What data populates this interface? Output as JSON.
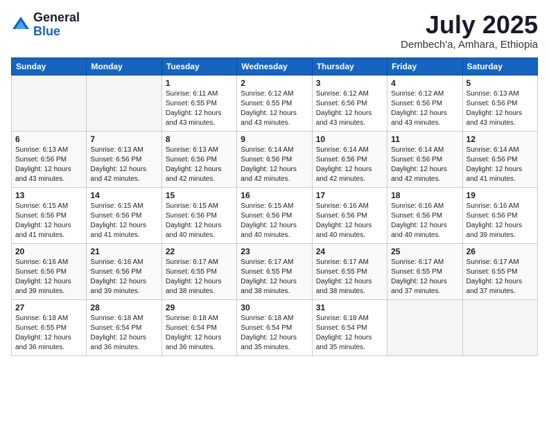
{
  "logo": {
    "general": "General",
    "blue": "Blue"
  },
  "header": {
    "month_year": "July 2025",
    "location": "Dembech'a, Amhara, Ethiopia"
  },
  "days_of_week": [
    "Sunday",
    "Monday",
    "Tuesday",
    "Wednesday",
    "Thursday",
    "Friday",
    "Saturday"
  ],
  "weeks": [
    [
      {
        "day": "",
        "detail": ""
      },
      {
        "day": "",
        "detail": ""
      },
      {
        "day": "1",
        "detail": "Sunrise: 6:11 AM\nSunset: 6:55 PM\nDaylight: 12 hours\nand 43 minutes."
      },
      {
        "day": "2",
        "detail": "Sunrise: 6:12 AM\nSunset: 6:55 PM\nDaylight: 12 hours\nand 43 minutes."
      },
      {
        "day": "3",
        "detail": "Sunrise: 6:12 AM\nSunset: 6:56 PM\nDaylight: 12 hours\nand 43 minutes."
      },
      {
        "day": "4",
        "detail": "Sunrise: 6:12 AM\nSunset: 6:56 PM\nDaylight: 12 hours\nand 43 minutes."
      },
      {
        "day": "5",
        "detail": "Sunrise: 6:13 AM\nSunset: 6:56 PM\nDaylight: 12 hours\nand 43 minutes."
      }
    ],
    [
      {
        "day": "6",
        "detail": "Sunrise: 6:13 AM\nSunset: 6:56 PM\nDaylight: 12 hours\nand 43 minutes."
      },
      {
        "day": "7",
        "detail": "Sunrise: 6:13 AM\nSunset: 6:56 PM\nDaylight: 12 hours\nand 42 minutes."
      },
      {
        "day": "8",
        "detail": "Sunrise: 6:13 AM\nSunset: 6:56 PM\nDaylight: 12 hours\nand 42 minutes."
      },
      {
        "day": "9",
        "detail": "Sunrise: 6:14 AM\nSunset: 6:56 PM\nDaylight: 12 hours\nand 42 minutes."
      },
      {
        "day": "10",
        "detail": "Sunrise: 6:14 AM\nSunset: 6:56 PM\nDaylight: 12 hours\nand 42 minutes."
      },
      {
        "day": "11",
        "detail": "Sunrise: 6:14 AM\nSunset: 6:56 PM\nDaylight: 12 hours\nand 42 minutes."
      },
      {
        "day": "12",
        "detail": "Sunrise: 6:14 AM\nSunset: 6:56 PM\nDaylight: 12 hours\nand 41 minutes."
      }
    ],
    [
      {
        "day": "13",
        "detail": "Sunrise: 6:15 AM\nSunset: 6:56 PM\nDaylight: 12 hours\nand 41 minutes."
      },
      {
        "day": "14",
        "detail": "Sunrise: 6:15 AM\nSunset: 6:56 PM\nDaylight: 12 hours\nand 41 minutes."
      },
      {
        "day": "15",
        "detail": "Sunrise: 6:15 AM\nSunset: 6:56 PM\nDaylight: 12 hours\nand 40 minutes."
      },
      {
        "day": "16",
        "detail": "Sunrise: 6:15 AM\nSunset: 6:56 PM\nDaylight: 12 hours\nand 40 minutes."
      },
      {
        "day": "17",
        "detail": "Sunrise: 6:16 AM\nSunset: 6:56 PM\nDaylight: 12 hours\nand 40 minutes."
      },
      {
        "day": "18",
        "detail": "Sunrise: 6:16 AM\nSunset: 6:56 PM\nDaylight: 12 hours\nand 40 minutes."
      },
      {
        "day": "19",
        "detail": "Sunrise: 6:16 AM\nSunset: 6:56 PM\nDaylight: 12 hours\nand 39 minutes."
      }
    ],
    [
      {
        "day": "20",
        "detail": "Sunrise: 6:16 AM\nSunset: 6:56 PM\nDaylight: 12 hours\nand 39 minutes."
      },
      {
        "day": "21",
        "detail": "Sunrise: 6:16 AM\nSunset: 6:56 PM\nDaylight: 12 hours\nand 39 minutes."
      },
      {
        "day": "22",
        "detail": "Sunrise: 6:17 AM\nSunset: 6:55 PM\nDaylight: 12 hours\nand 38 minutes."
      },
      {
        "day": "23",
        "detail": "Sunrise: 6:17 AM\nSunset: 6:55 PM\nDaylight: 12 hours\nand 38 minutes."
      },
      {
        "day": "24",
        "detail": "Sunrise: 6:17 AM\nSunset: 6:55 PM\nDaylight: 12 hours\nand 38 minutes."
      },
      {
        "day": "25",
        "detail": "Sunrise: 6:17 AM\nSunset: 6:55 PM\nDaylight: 12 hours\nand 37 minutes."
      },
      {
        "day": "26",
        "detail": "Sunrise: 6:17 AM\nSunset: 6:55 PM\nDaylight: 12 hours\nand 37 minutes."
      }
    ],
    [
      {
        "day": "27",
        "detail": "Sunrise: 6:18 AM\nSunset: 6:55 PM\nDaylight: 12 hours\nand 36 minutes."
      },
      {
        "day": "28",
        "detail": "Sunrise: 6:18 AM\nSunset: 6:54 PM\nDaylight: 12 hours\nand 36 minutes."
      },
      {
        "day": "29",
        "detail": "Sunrise: 6:18 AM\nSunset: 6:54 PM\nDaylight: 12 hours\nand 36 minutes."
      },
      {
        "day": "30",
        "detail": "Sunrise: 6:18 AM\nSunset: 6:54 PM\nDaylight: 12 hours\nand 35 minutes."
      },
      {
        "day": "31",
        "detail": "Sunrise: 6:18 AM\nSunset: 6:54 PM\nDaylight: 12 hours\nand 35 minutes."
      },
      {
        "day": "",
        "detail": ""
      },
      {
        "day": "",
        "detail": ""
      }
    ]
  ]
}
